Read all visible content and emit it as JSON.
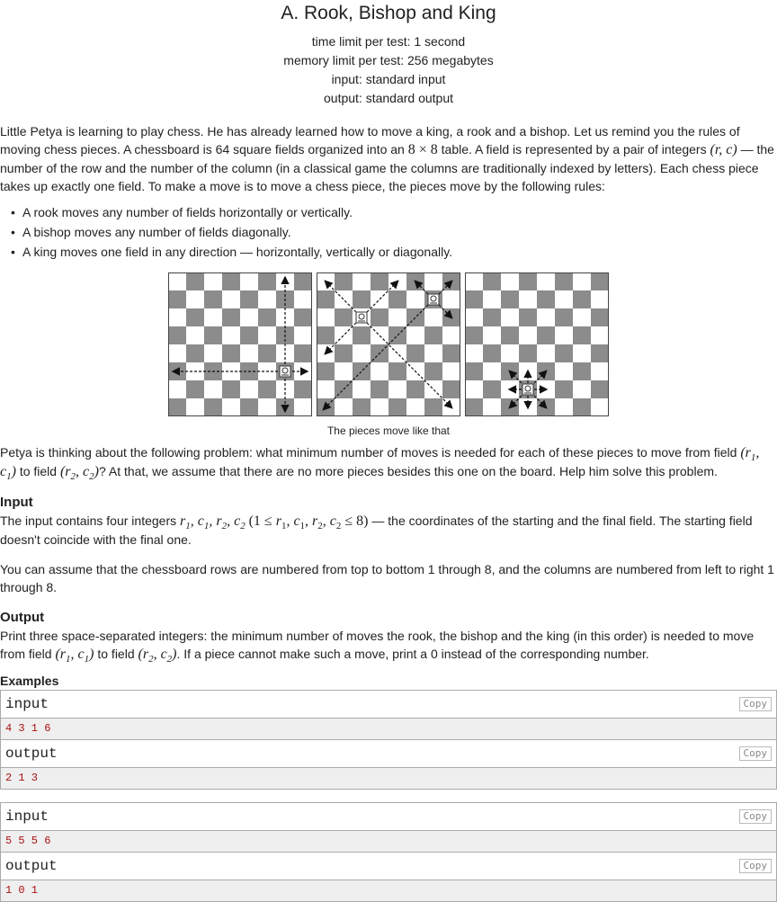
{
  "problem": {
    "title": "A. Rook, Bishop and King",
    "limits": [
      "time limit per test: 1 second",
      "memory limit per test: 256 megabytes",
      "input: standard input",
      "output: standard output"
    ]
  },
  "statement": {
    "p1_a": "Little Petya is learning to play chess. He has already learned how to move a king, a rook and a bishop. Let us remind you the rules of moving chess pieces. A chessboard is 64 square fields organized into an ",
    "p1_m1": "8 × 8",
    "p1_b": " table. A field is represented by a pair of integers ",
    "p1_m2": "(r, c)",
    "p1_c": " — the number of the row and the number of the column (in a classical game the columns are traditionally indexed by letters). Each chess piece takes up exactly one field. To make a move is to move a chess piece, the pieces move by the following rules:",
    "rules": [
      "A rook moves any number of fields horizontally or vertically.",
      "A bishop moves any number of fields diagonally.",
      "A king moves one field in any direction — horizontally, vertically or diagonally."
    ],
    "figure_caption": "The pieces move like that",
    "p2_a": "Petya is thinking about the following problem: what minimum number of moves is needed for each of these pieces to move from field ",
    "p2_b": " to field ",
    "p2_c": "? At that, we assume that there are no more pieces besides this one on the board. Help him solve this problem."
  },
  "input_section": {
    "title": "Input",
    "p_a": "The input contains four integers ",
    "p_b": " — the coordinates of the starting and the final field. The starting field doesn't coincide with the final one.",
    "p2": "You can assume that the chessboard rows are numbered from top to bottom 1 through 8, and the columns are numbered from left to right 1 through 8."
  },
  "output_section": {
    "title": "Output",
    "p_a": "Print three space-separated integers: the minimum number of moves the rook, the bishop and the king (in this order) is needed to move from field ",
    "p_b": " to field ",
    "p_c": ". If a piece cannot make such a move, print a 0 instead of the corresponding number."
  },
  "examples": {
    "title": "Examples",
    "input_label": "input",
    "output_label": "output",
    "copy_label": "Copy",
    "items": [
      {
        "input": "4 3 1 6",
        "output": "2 1 3"
      },
      {
        "input": "5 5 5 6",
        "output": "1 0 1"
      }
    ]
  }
}
